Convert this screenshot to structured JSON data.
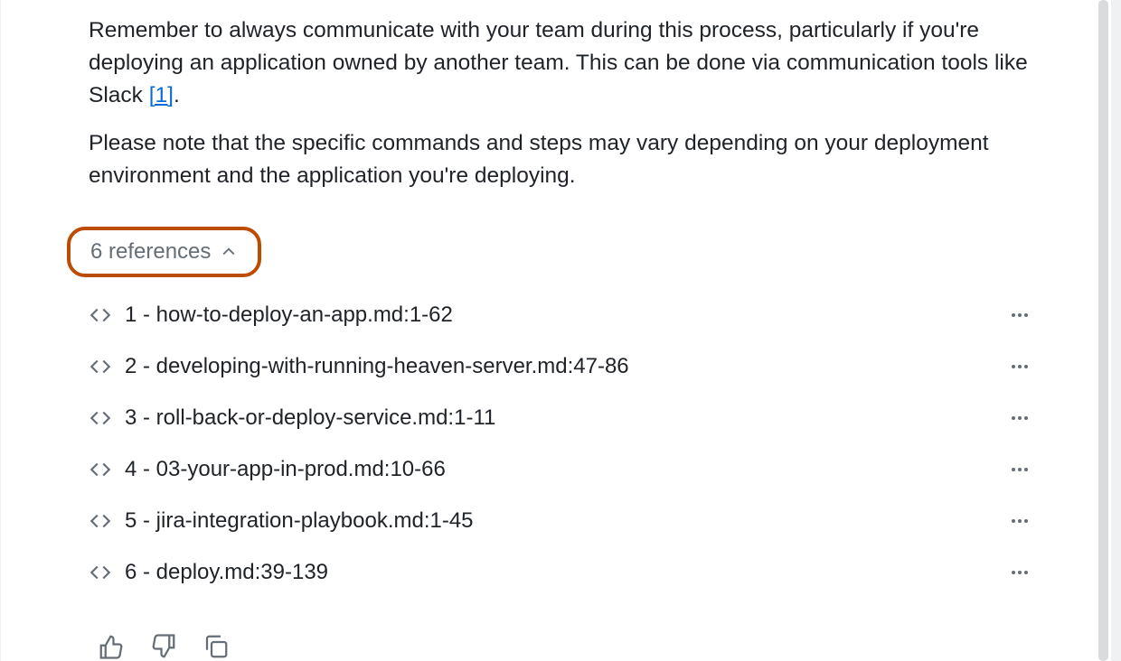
{
  "message": {
    "paragraph1_pre": "Remember to always communicate with your team during this process, particularly if you're deploying an application owned by another team. This can be done via communication tools like Slack ",
    "citation1_label": "[1]",
    "paragraph1_post": ".",
    "paragraph2": "Please note that the specific commands and steps may vary depending on your deployment environment and the application you're deploying."
  },
  "references": {
    "toggle_label": "6 references",
    "items": [
      {
        "label": "1 - how-to-deploy-an-app.md:1-62"
      },
      {
        "label": "2 - developing-with-running-heaven-server.md:47-86"
      },
      {
        "label": "3 - roll-back-or-deploy-service.md:1-11"
      },
      {
        "label": "4 - 03-your-app-in-prod.md:10-66"
      },
      {
        "label": "5 - jira-integration-playbook.md:1-45"
      },
      {
        "label": "6 - deploy.md:39-139"
      }
    ]
  },
  "highlight_color": "#bc4c00",
  "link_color": "#0969da"
}
